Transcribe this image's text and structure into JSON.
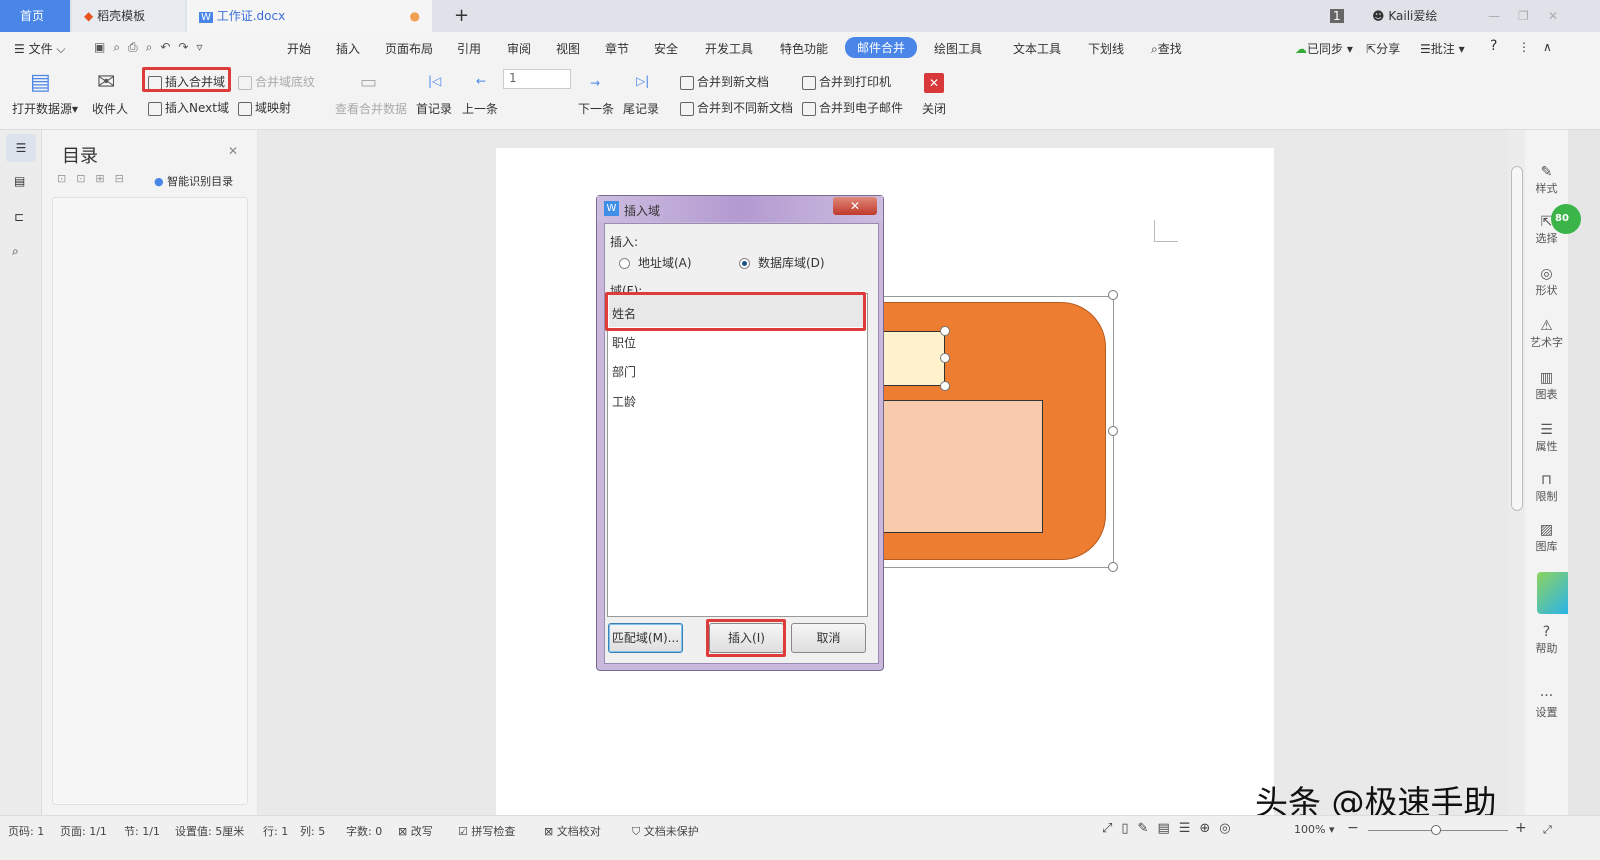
{
  "tabs": [
    {
      "label": "首页"
    },
    {
      "label": "稻壳模板"
    },
    {
      "label": "工作证.docx"
    }
  ],
  "titlebar": {
    "badge": "1",
    "user": "Kaili爱绘",
    "new_tab": "+"
  },
  "menu": {
    "file": "文件",
    "items": [
      "开始",
      "插入",
      "页面布局",
      "引用",
      "审阅",
      "视图",
      "章节",
      "安全",
      "开发工具",
      "特色功能",
      "邮件合并",
      "绘图工具",
      "文本工具",
      "下划线"
    ],
    "search": "查找",
    "sync": "已同步",
    "share": "分享",
    "comment": "批注",
    "help": "?"
  },
  "ribbon": {
    "open_source": "打开数据源",
    "recipients": "收件人",
    "insert_merge_field": "插入合并域",
    "merge_field_shading": "合并域底纹",
    "insert_next": "插入Next域",
    "field_mapping": "域映射",
    "view_merged": "查看合并数据",
    "first": "首记录",
    "prev": "上一条",
    "record": "1",
    "next": "下一条",
    "last": "尾记录",
    "merge_new": "合并到新文档",
    "merge_diff": "合并到不同新文档",
    "merge_printer": "合并到打印机",
    "merge_email": "合并到电子邮件",
    "close": "关闭"
  },
  "nav": {
    "title": "目录",
    "smart": "智能识别目录"
  },
  "dialog": {
    "title": "插入域",
    "insert_label": "插入:",
    "radio_address": "地址域(A)",
    "radio_db": "数据库域(D)",
    "selected_radio": "数据库域(D)",
    "fields_label": "域(F):",
    "fields": [
      "姓名",
      "职位",
      "部门",
      "工龄"
    ],
    "selected_field": "姓名",
    "match_btn": "匹配域(M)...",
    "insert_btn": "插入(I)",
    "cancel_btn": "取消"
  },
  "rightbar": [
    {
      "label": "样式"
    },
    {
      "label": "选择"
    },
    {
      "label": "形状"
    },
    {
      "label": "艺术字"
    },
    {
      "label": "图表"
    },
    {
      "label": "属性"
    },
    {
      "label": "限制"
    },
    {
      "label": "图库"
    },
    {
      "label": "帮助"
    },
    {
      "label": "设置"
    }
  ],
  "status": {
    "page": "页码: 1",
    "pages": "页面: 1/1",
    "section": "节: 1/1",
    "setting": "设置值: 5厘米",
    "row": "行: 1",
    "col": "列: 5",
    "words": "字数: 0",
    "revise": "改写",
    "spell": "拼写检查",
    "proof": "文档校对",
    "protect": "文档未保护",
    "zoom": "100%"
  },
  "watermark": "头条 @极速手助",
  "colors": {
    "accent": "#4a86e8",
    "shape_orange": "#ed7d31",
    "shape_yellow": "#fff2cc",
    "shape_peach": "#f8cbad",
    "highlight": "#e03b3b"
  }
}
